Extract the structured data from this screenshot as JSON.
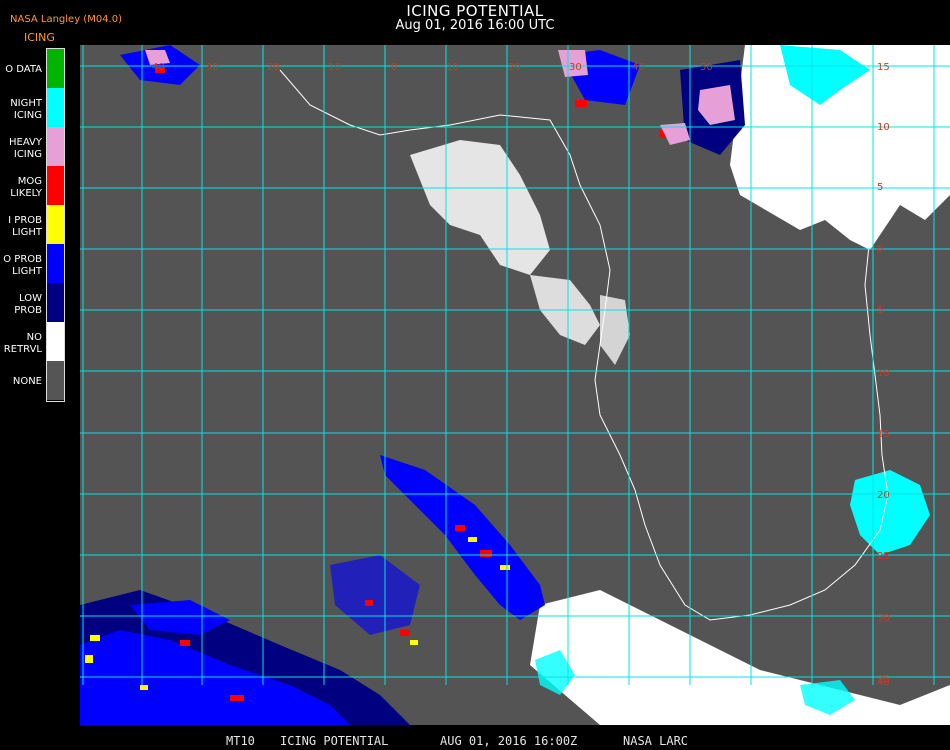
{
  "header": {
    "title": "ICING POTENTIAL",
    "subtitle": "Aug 01, 2016 16:00 UTC",
    "producer": "NASA Langley (M04.0)",
    "product": "ICING"
  },
  "legend": [
    {
      "label": "O DATA",
      "color": "#00b400"
    },
    {
      "label": "NIGHT\nICING",
      "color": "#00ffff"
    },
    {
      "label": "HEAVY\nICING",
      "color": "#e6a0d7"
    },
    {
      "label": "MOG\nLIKELY",
      "color": "#ff0000"
    },
    {
      "label": "I PROB\nLIGHT",
      "color": "#ffff00"
    },
    {
      "label": "O PROB\nLIGHT",
      "color": "#0000ff"
    },
    {
      "label": "LOW\nPROB",
      "color": "#000080"
    },
    {
      "label": "NO\nRETRVL",
      "color": "#ffffff"
    },
    {
      "label": "NONE",
      "color": "#555555"
    }
  ],
  "map": {
    "background": "#545454",
    "grid_color": "#00e5e5",
    "label_color": "#c83a2a",
    "top_labels": [
      "40",
      "30",
      "20",
      "10",
      "0",
      "10",
      "20",
      "30",
      "40",
      "50"
    ],
    "right_labels": [
      "15",
      "10",
      "5",
      "0",
      "5",
      "10",
      "15",
      "20",
      "25",
      "30",
      "35",
      "40"
    ]
  },
  "footer": {
    "satellite": "MT10",
    "product": "ICING POTENTIAL",
    "date": "AUG 01, 2016 16:00Z",
    "source": "NASA LARC"
  }
}
